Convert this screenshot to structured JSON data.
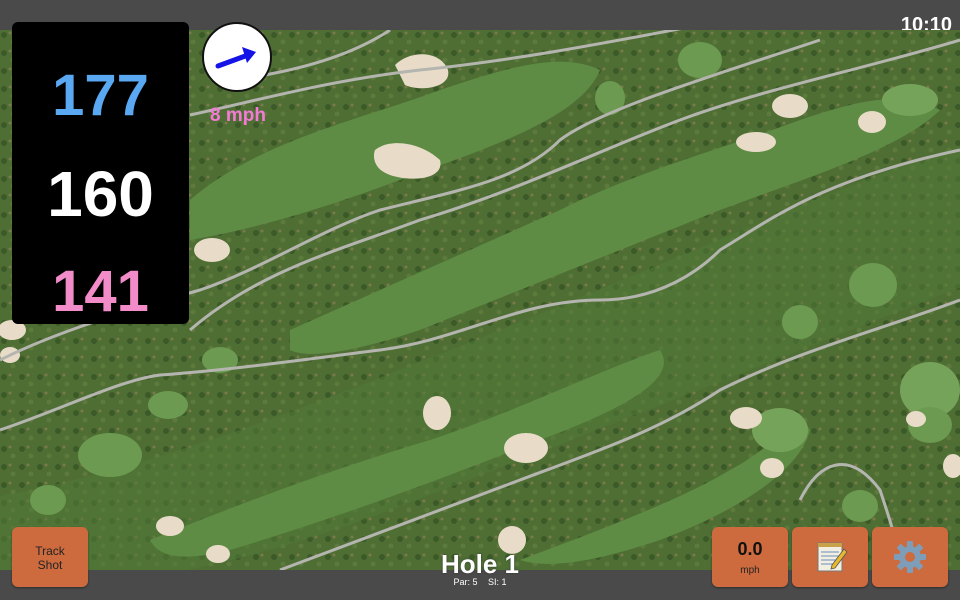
{
  "status": {
    "time": "10:10"
  },
  "distances": {
    "back": "177",
    "middle": "160",
    "front": "141"
  },
  "wind": {
    "speed": "8 mph",
    "icon": "wind-direction-arrow-icon"
  },
  "hole": {
    "title": "Hole 1",
    "par": "Par: 5",
    "stroke_index": "SI: 1"
  },
  "buttons": {
    "track_shot": "Track\nShot",
    "speed_value": "0.0",
    "speed_unit": "mph",
    "notes_icon": "notepad-icon",
    "settings_icon": "gear-icon"
  },
  "colors": {
    "back": "#5aa8f2",
    "middle": "#ffffff",
    "front": "#f28cc8",
    "wind_text": "#f57ad7",
    "button": "#cd6b3f",
    "bar": "#4a4a4a"
  }
}
